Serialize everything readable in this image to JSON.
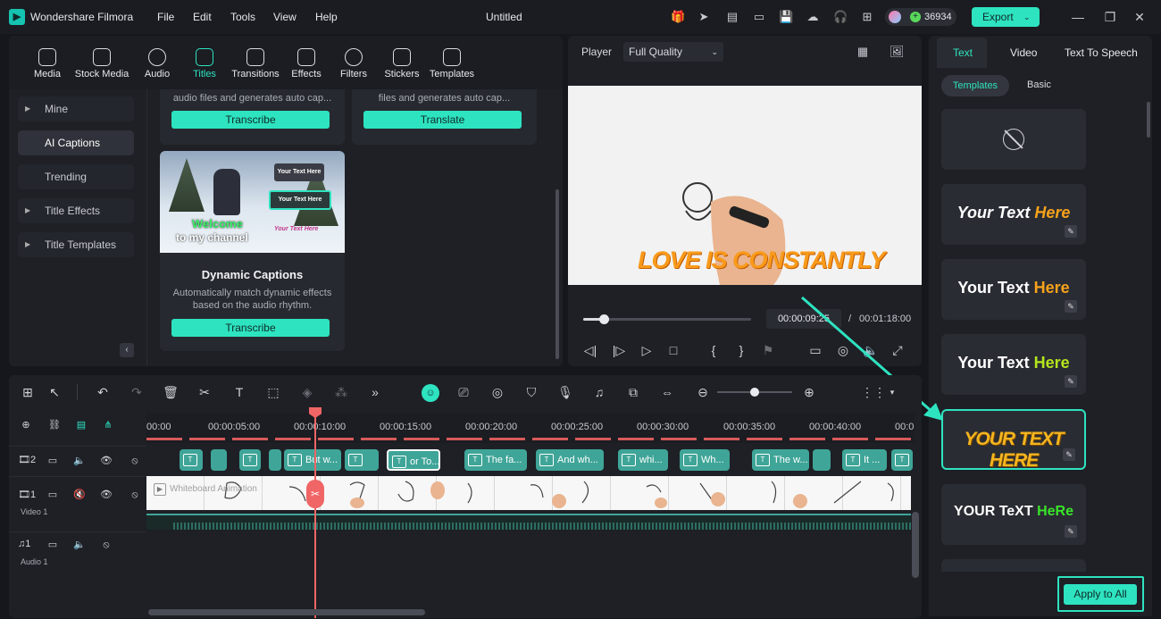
{
  "app": {
    "name": "Wondershare Filmora",
    "menu": [
      "File",
      "Edit",
      "Tools",
      "View",
      "Help"
    ],
    "doc_title": "Untitled",
    "credits": "36934",
    "export_label": "Export",
    "accent": "#2ee3c0"
  },
  "tabs": [
    {
      "label": "Media",
      "icon": "media-icon"
    },
    {
      "label": "Stock Media",
      "icon": "stock-media-icon"
    },
    {
      "label": "Audio",
      "icon": "audio-icon"
    },
    {
      "label": "Titles",
      "icon": "titles-icon",
      "active": true
    },
    {
      "label": "Transitions",
      "icon": "transitions-icon"
    },
    {
      "label": "Effects",
      "icon": "effects-icon"
    },
    {
      "label": "Filters",
      "icon": "filters-icon"
    },
    {
      "label": "Stickers",
      "icon": "stickers-icon"
    },
    {
      "label": "Templates",
      "icon": "templates-icon"
    }
  ],
  "sidebar": [
    "Mine",
    "AI Captions",
    "Trending",
    "Title Effects",
    "Title Templates"
  ],
  "captions": {
    "card1_desc": "audio files and generates auto cap...",
    "card1_btn": "Transcribe",
    "card2_desc": "files and generates auto cap...",
    "card2_btn": "Translate",
    "dynamic_title": "Dynamic Captions",
    "dynamic_desc": "Automatically match dynamic effects based on the audio rhythm.",
    "dynamic_btn": "Transcribe",
    "thumb_welcome": "Welcome",
    "thumb_channel": "to my channel",
    "thumb_tag1": "Your Text Here",
    "thumb_tag2": "Your Text Here",
    "thumb_tag3": "Your Text Here"
  },
  "player": {
    "label": "Player",
    "quality": "Full Quality",
    "overlay_text": "LOVE IS CONSTANTLY",
    "current_time": "00:00:09:25",
    "separator": "/",
    "total_time": "00:01:18:00",
    "progress": 0.12
  },
  "right": {
    "tabs": [
      "Text",
      "Video",
      "Text To Speech"
    ],
    "subtabs": [
      "Templates",
      "Basic"
    ],
    "templates": [
      {
        "text_a": "Your Text ",
        "text_b": "Here",
        "color_a": "#ffffff",
        "color_b": "#f7a21b"
      },
      {
        "text_a": "Your Text ",
        "text_b": "Here",
        "color_a": "#ffffff",
        "color_b": "#f7a21b"
      },
      {
        "text_a": "Your Text ",
        "text_b": "Here",
        "color_a": "#ffffff",
        "color_b": "#b5e61d"
      },
      {
        "text_a": "YOUR TEXT HERE",
        "text_b": "",
        "color_a": "#f5b51f",
        "color_b": "#f5b51f"
      },
      {
        "text_a": "YOUR TeXT ",
        "text_b": "HeRe",
        "color_a": "#ffffff",
        "color_b": "#39e52a"
      }
    ],
    "apply_label": "Apply to All"
  },
  "timeline": {
    "ruler": [
      "00:00",
      "00:00:05:00",
      "00:00:10:00",
      "00:00:15:00",
      "00:00:20:00",
      "00:00:25:00",
      "00:00:30:00",
      "00:00:35:00",
      "00:00:40:00",
      "00:0"
    ],
    "tracks": [
      {
        "num": "2",
        "label": ""
      },
      {
        "num": "1",
        "label": "Video 1"
      },
      {
        "num": "1",
        "label": "Audio 1"
      }
    ],
    "clips": [
      "",
      "",
      "",
      "",
      "But w...",
      "",
      "or To...",
      "The fa...",
      "And wh...",
      "whi...",
      "Wh...",
      "The w...",
      "",
      "It ...",
      ""
    ],
    "video_clip_name": "Whiteboard Animation"
  }
}
